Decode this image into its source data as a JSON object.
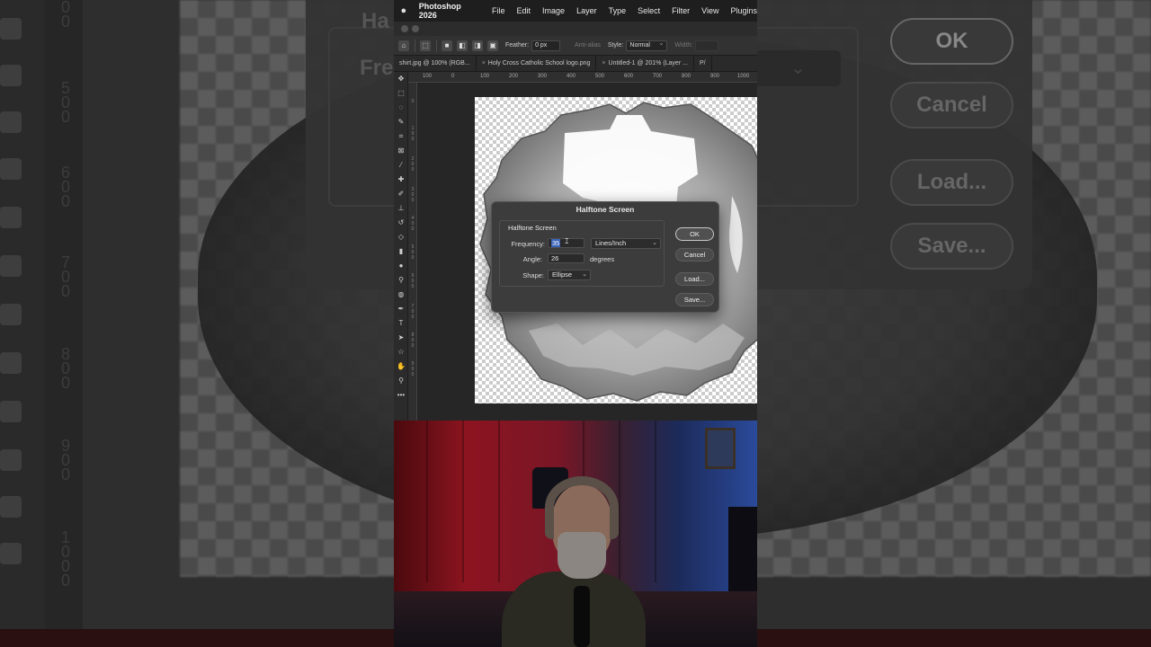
{
  "background": {
    "dialog_label_1": "Ha",
    "dialog_label_2": "Fre",
    "buttons": [
      "OK",
      "Cancel",
      "Load...",
      "Save..."
    ]
  },
  "menubar": {
    "app_name": "Photoshop 2026",
    "items": [
      "File",
      "Edit",
      "Image",
      "Layer",
      "Type",
      "Select",
      "Filter",
      "View",
      "Plugins"
    ]
  },
  "options_bar": {
    "feather_label": "Feather:",
    "feather_value": "0 px",
    "antialias_label": "Anti-alias",
    "style_label": "Style:",
    "style_value": "Normal",
    "width_label": "Width:"
  },
  "tabs": [
    "shirt.jpg @ 100% (RGB...",
    "Holy Cross Catholic School logo.png",
    "Untitled-1 @ 201% (Layer ...",
    "P/"
  ],
  "ruler": {
    "top_ticks": [
      "100",
      "0",
      "100",
      "200",
      "300",
      "400",
      "500",
      "600",
      "700",
      "800",
      "900",
      "1000"
    ]
  },
  "dialog": {
    "title": "Halftone Screen",
    "group_title": "Halftone Screen",
    "frequency_label": "Frequency:",
    "frequency_value": "35",
    "frequency_unit": "Lines/Inch",
    "angle_label": "Angle:",
    "angle_value": "26",
    "angle_unit": "degrees",
    "shape_label": "Shape:",
    "shape_value": "Ellipse",
    "ok_label": "OK",
    "cancel_label": "Cancel",
    "load_label": "Load...",
    "save_label": "Save..."
  },
  "colors": {
    "selection_highlight": "#3862b8",
    "dialog_bg": "#3c3c3c",
    "webcam_red": "#8c1420",
    "webcam_blue": "#2a4a9a"
  }
}
